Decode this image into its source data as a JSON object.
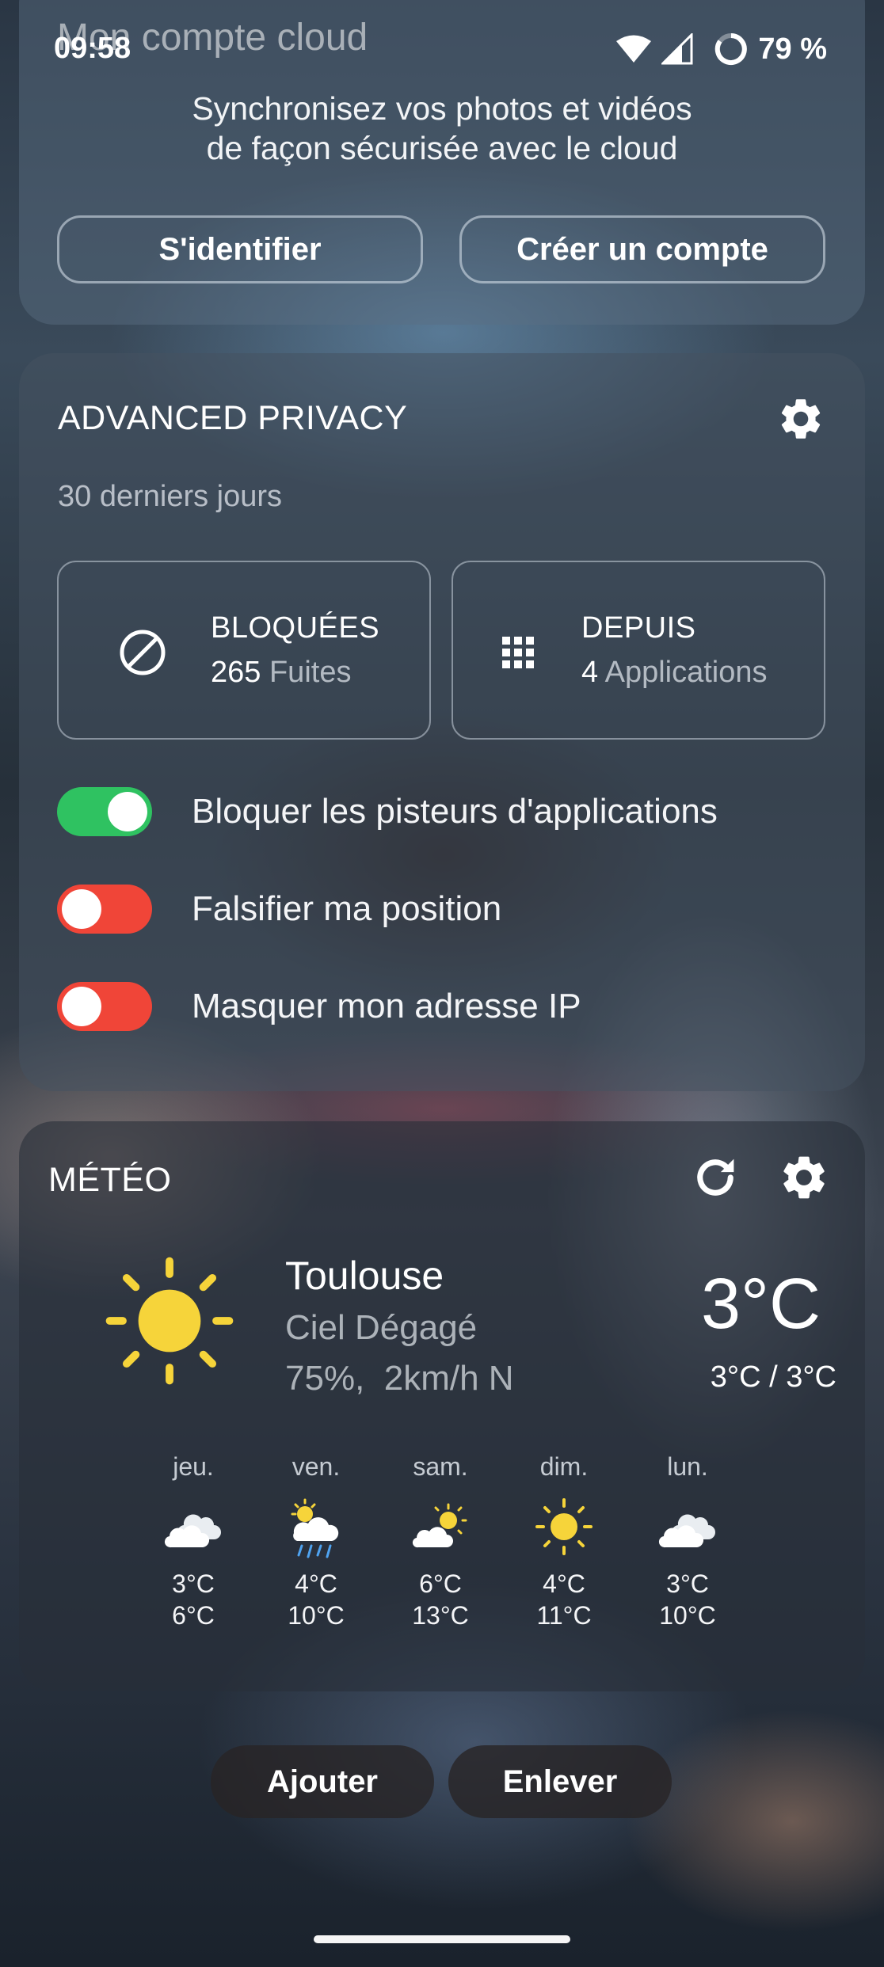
{
  "status_bar": {
    "time": "09:58",
    "battery_percent": "79 %",
    "icons": [
      "wifi-icon",
      "signal-icon",
      "battery-ring-icon"
    ]
  },
  "cloud": {
    "title": "Mon compte cloud",
    "description_line1": "Synchronisez vos photos et vidéos",
    "description_line2": "de façon sécurisée avec le cloud",
    "login_label": "S'identifier",
    "create_account_label": "Créer un compte"
  },
  "privacy": {
    "title": "ADVANCED PRIVACY",
    "settings_icon": "gear-icon",
    "period": "30 derniers jours",
    "blocked": {
      "label": "BLOQUÉES",
      "count": "265",
      "unit": "Fuites",
      "icon": "block-icon"
    },
    "apps": {
      "label": "DEPUIS",
      "count": "4",
      "unit": "Applications",
      "icon": "apps-grid-icon"
    },
    "toggles": [
      {
        "label": "Bloquer les pisteurs d'applications",
        "state": "on"
      },
      {
        "label": "Falsifier ma position",
        "state": "off"
      },
      {
        "label": "Masquer mon adresse IP",
        "state": "off"
      }
    ],
    "colors": {
      "toggle_on": "#2fc261",
      "toggle_off": "#f04538"
    }
  },
  "weather": {
    "title": "MÉTÉO",
    "refresh_icon": "refresh-icon",
    "settings_icon": "gear-icon",
    "city": "Toulouse",
    "condition": "Ciel Dégagé",
    "humidity_wind": "75%,  2km/h N",
    "current_temp": "3°C",
    "minmax": "3°C / 3°C",
    "current_icon": "sun-icon",
    "forecast": [
      {
        "day": "jeu.",
        "icon": "cloudy-icon",
        "min": "3°C",
        "max": "6°C"
      },
      {
        "day": "ven.",
        "icon": "rain-icon",
        "min": "4°C",
        "max": "10°C"
      },
      {
        "day": "sam.",
        "icon": "partly-sunny-icon",
        "min": "6°C",
        "max": "13°C"
      },
      {
        "day": "dim.",
        "icon": "sun-icon",
        "min": "4°C",
        "max": "11°C"
      },
      {
        "day": "lun.",
        "icon": "cloudy-icon",
        "min": "3°C",
        "max": "10°C"
      }
    ]
  },
  "bottom": {
    "add_label": "Ajouter",
    "remove_label": "Enlever"
  }
}
